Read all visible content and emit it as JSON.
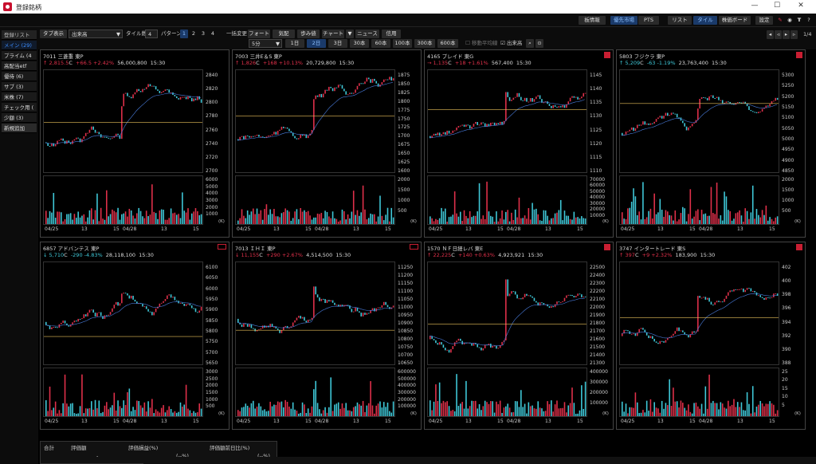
{
  "window": {
    "title": "登録銘柄",
    "minimize": "—",
    "maximize": "☐",
    "close": "✕"
  },
  "toolbar_top": {
    "buttons": [
      {
        "id": "kibetsu",
        "label": "板情報"
      },
      {
        "id": "prio",
        "label": "優先市場"
      },
      {
        "id": "pts",
        "label": "PTS"
      },
      {
        "id": "list",
        "label": "リスト"
      },
      {
        "id": "tile",
        "label": "タイル"
      },
      {
        "id": "board",
        "label": "株価ボード"
      },
      {
        "id": "settings",
        "label": "設定"
      }
    ]
  },
  "sidebar": {
    "title": "登録リスト",
    "items": [
      {
        "label": "メイン (29)",
        "selected": true
      },
      {
        "label": "プライム (4"
      },
      {
        "label": "高配当etf"
      },
      {
        "label": "優待 (6)"
      },
      {
        "label": "サブ (3)"
      },
      {
        "label": "米株 (7)"
      },
      {
        "label": "チェック用 ("
      },
      {
        "label": "少額 (3)"
      },
      {
        "label": "新規追加"
      }
    ]
  },
  "toolbar2": {
    "tab_label": "タブ表示",
    "tab_value": "出来高",
    "tile_label": "タイル数",
    "tile_value": "4",
    "pattern_label": "パターン",
    "patterns": [
      "1",
      "2",
      "3",
      "4"
    ],
    "bulk_label": "一括変更",
    "btns": [
      "フォート",
      "気配",
      "歩み値",
      "チャート",
      "ニュース",
      "信用"
    ],
    "interval": "5分",
    "periods": [
      "1日",
      "2日",
      "3日",
      "30本",
      "60本",
      "100本",
      "300本",
      "600本"
    ],
    "opt_ma": "移動平均線",
    "opt_vol": "出来高",
    "page": "1/4"
  },
  "panels": [
    {
      "header": "7011  三菱重   東P",
      "arrow": "↑",
      "price": "2,815.5",
      "pc": "C",
      "change": "+66.5 +2.42%",
      "dir": "up",
      "volume": "56,000,800",
      "time": "15:30",
      "alarm": false,
      "yticks": [
        "2840",
        "2820",
        "2800",
        "2780",
        "2760",
        "2740",
        "2720",
        "2700"
      ],
      "vticks": [
        "6000",
        "5000",
        "4000",
        "3000",
        "2000",
        "1000"
      ],
      "xlabels": [
        "04/25",
        "13",
        "15",
        "04/28",
        "13",
        "15"
      ]
    },
    {
      "header": "7003  三井E＆S   東P",
      "arrow": "↑",
      "price": "1,826",
      "pc": "C",
      "change": "+168 +10.13%",
      "dir": "up",
      "volume": "20,729,800",
      "time": "15:30",
      "alarm": false,
      "yticks": [
        "1875",
        "1850",
        "1825",
        "1800",
        "1775",
        "1750",
        "1725",
        "1700",
        "1675",
        "1650",
        "1625",
        "1600"
      ],
      "vticks": [
        "2000",
        "1500",
        "1000",
        "500"
      ],
      "xlabels": [
        "04/25",
        "13",
        "15",
        "04/28",
        "13",
        "15"
      ]
    },
    {
      "header": "4165  プレイド   東G",
      "arrow": "→",
      "price": "1,135",
      "pc": "C",
      "change": "+18 +1.61%",
      "dir": "up",
      "volume": "567,400",
      "time": "15:30",
      "alarm": true,
      "yticks": [
        "1145",
        "1140",
        "1135",
        "1130",
        "1125",
        "1120",
        "1115",
        "1110"
      ],
      "vticks": [
        "70000",
        "60000",
        "50000",
        "40000",
        "30000",
        "20000",
        "10000"
      ],
      "xlabels": [
        "04/25",
        "13",
        "15",
        "04/28",
        "13",
        "15"
      ]
    },
    {
      "header": "5803  フジクラ   東P",
      "arrow": "↑",
      "price": "5,209",
      "pc": "C",
      "change": "-63 -1.19%",
      "dir": "dn",
      "volume": "23,763,400",
      "time": "15:30",
      "alarm": true,
      "yticks": [
        "5300",
        "5250",
        "5200",
        "5150",
        "5100",
        "5050",
        "5000",
        "4950",
        "4900",
        "4850"
      ],
      "vticks": [
        "2000",
        "1500",
        "1000",
        "500"
      ],
      "xlabels": [
        "04/25",
        "13",
        "15",
        "04/28",
        "13",
        "15"
      ]
    },
    {
      "header": "6857  アドバンテス   東P",
      "arrow": "↓",
      "price": "5,710",
      "pc": "C",
      "change": "-290 -4.83%",
      "dir": "dn",
      "volume": "28,118,100",
      "time": "15:30",
      "alarm": false,
      "outline": true,
      "yticks": [
        "6100",
        "6050",
        "6000",
        "5950",
        "5900",
        "5850",
        "5800",
        "5750",
        "5700",
        "5650"
      ],
      "vticks": [
        "3000",
        "2500",
        "2000",
        "1500",
        "1000",
        "500"
      ],
      "xlabels": [
        "04/25",
        "13",
        "15",
        "04/28",
        "13",
        "15"
      ]
    },
    {
      "header": "7013  ＩＨＩ   東P",
      "arrow": "↓",
      "price": "11,155",
      "pc": "C",
      "change": "+290 +2.67%",
      "dir": "up",
      "volume": "4,514,500",
      "time": "15:30",
      "alarm": false,
      "outline": true,
      "yticks": [
        "11250",
        "11200",
        "11150",
        "11100",
        "11050",
        "11000",
        "10950",
        "10900",
        "10850",
        "10800",
        "10750",
        "10700",
        "10650"
      ],
      "vticks": [
        "600000",
        "500000",
        "400000",
        "300000",
        "200000",
        "100000"
      ],
      "xlabels": [
        "04/25",
        "13",
        "15",
        "04/28",
        "13",
        "15"
      ]
    },
    {
      "header": "1570  ＮＦ日経レバ   東E",
      "arrow": "↑",
      "price": "22,225",
      "pc": "C",
      "change": "+140 +0.63%",
      "dir": "up",
      "volume": "4,923,921",
      "time": "15:30",
      "alarm": true,
      "yticks": [
        "22500",
        "22400",
        "22300",
        "22200",
        "22100",
        "22000",
        "21900",
        "21800",
        "21700",
        "21600",
        "21500",
        "21400",
        "21300"
      ],
      "vticks": [
        "400000",
        "300000",
        "200000",
        "100000"
      ],
      "xlabels": [
        "04/25",
        "13",
        "15",
        "04/28",
        "13",
        "15"
      ]
    },
    {
      "header": "3747  インタートレード   東S",
      "arrow": "↑",
      "price": "397",
      "pc": "C",
      "change": "+9 +2.32%",
      "dir": "up",
      "volume": "183,900",
      "time": "15:30",
      "alarm": true,
      "yticks": [
        "402",
        "400",
        "398",
        "396",
        "394",
        "392",
        "390",
        "388"
      ],
      "vticks": [
        "25",
        "20",
        "15",
        "10",
        "5"
      ],
      "xlabels": [
        "04/25",
        "13",
        "15",
        "04/28",
        "13",
        "15"
      ]
    }
  ],
  "bottom": {
    "headers": [
      "合計",
      "評価額",
      "評価損益(%)",
      "評価額前日比(%)"
    ],
    "values": [
      "-",
      "(--%)",
      "(--%)"
    ]
  },
  "unit_k": "(K)",
  "colors": {
    "up": "#e0304a",
    "down": "#3fc8d8",
    "bg": "#000000",
    "accent": "#1a3a6a"
  }
}
